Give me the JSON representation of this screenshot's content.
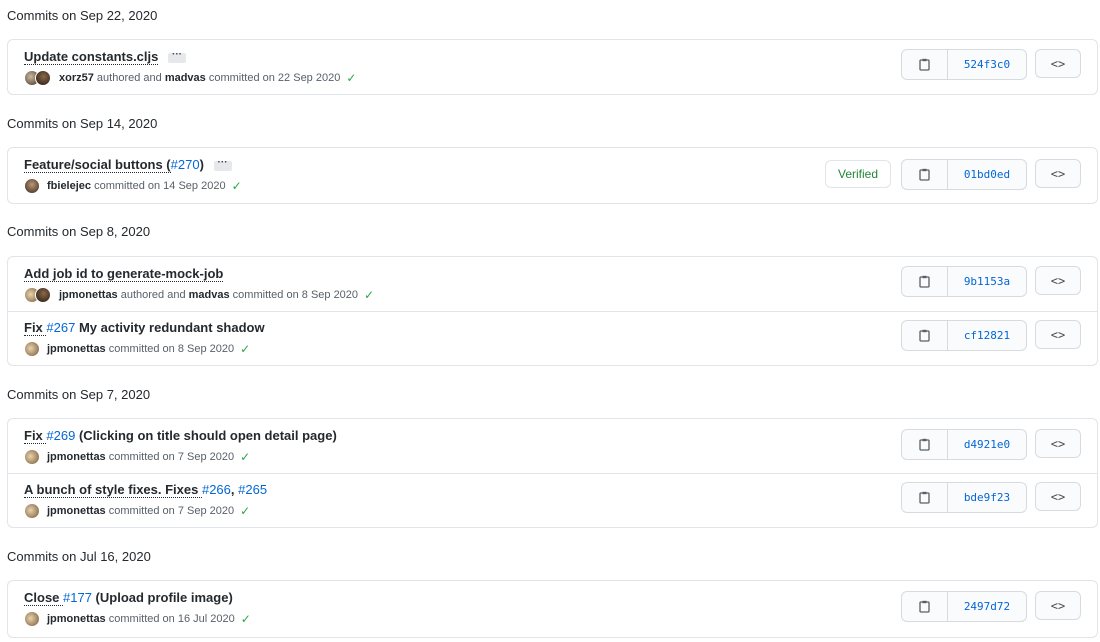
{
  "groups": [
    {
      "header": "Commits on Sep 22, 2020",
      "commits": [
        {
          "message": "Update constants.cljs",
          "author": "xorz57",
          "coauthor": "madvas",
          "authored_text": " authored and ",
          "committed_text": " committed on 22 Sep 2020",
          "sha": "524f3c0"
        }
      ]
    },
    {
      "header": "Commits on Sep 14, 2020",
      "commits": [
        {
          "message_pre": "Feature/social buttons (",
          "message_link": "#270",
          "message_post": ")",
          "author": "fbielejec",
          "committed_text": " committed on 14 Sep 2020",
          "verified": "Verified",
          "sha": "01bd0ed"
        }
      ]
    },
    {
      "header": "Commits on Sep 8, 2020",
      "commits": [
        {
          "message": "Add job id to generate-mock-job",
          "author": "jpmonettas",
          "coauthor": "madvas",
          "authored_text": " authored and ",
          "committed_text": " committed on 8 Sep 2020",
          "sha": "9b1153a"
        },
        {
          "message_pre": "Fix ",
          "message_link": "#267",
          "message_post": " My activity redundant shadow",
          "author": "jpmonettas",
          "committed_text": " committed on 8 Sep 2020",
          "sha": "cf12821"
        }
      ]
    },
    {
      "header": "Commits on Sep 7, 2020",
      "commits": [
        {
          "message_pre": "Fix ",
          "message_link": "#269",
          "message_post": " (Clicking on title should open detail page)",
          "author": "jpmonettas",
          "committed_text": " committed on 7 Sep 2020",
          "sha": "d4921e0"
        },
        {
          "message_pre": "A bunch of style fixes. Fixes ",
          "message_link": "#266",
          "message_mid": ", ",
          "message_link2": "#265",
          "author": "jpmonettas",
          "committed_text": " committed on 7 Sep 2020",
          "sha": "bde9f23"
        }
      ]
    },
    {
      "header": "Commits on Jul 16, 2020",
      "commits": [
        {
          "message_pre": "Close ",
          "message_link": "#177",
          "message_post": " (Upload profile image)",
          "author": "jpmonettas",
          "committed_text": " committed on 16 Jul 2020",
          "sha": "2497d72"
        }
      ]
    }
  ],
  "icons": {
    "ellipsis": "···",
    "check": "✓",
    "browse": "<>"
  },
  "colors": {
    "link": "#0366d6",
    "check": "#28a745",
    "verified": "#22863a",
    "border": "#e1e4e8"
  }
}
